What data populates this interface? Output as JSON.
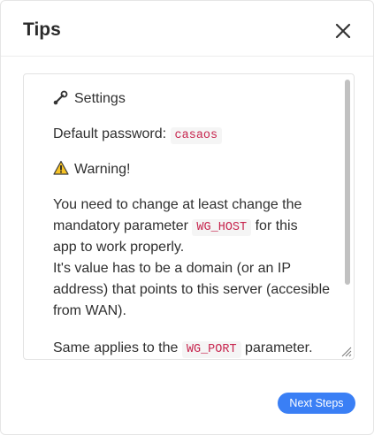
{
  "dialog": {
    "title": "Tips",
    "close_icon": "close-icon"
  },
  "tips": {
    "settings_icon": "wrench-icon",
    "settings_heading": "Settings",
    "default_password_label": "Default password:",
    "default_password_value": "casaos",
    "warning_icon": "warning-icon",
    "warning_heading": "Warning!",
    "paragraph1_line1": "You need to change at least change the",
    "paragraph1_line2_pre": "mandatory parameter",
    "paragraph1_code": "WG_HOST",
    "paragraph1_line2_post": "for this",
    "paragraph1_line3": "app to work properly.",
    "paragraph2_line1": "It's value has to be a domain (or an IP",
    "paragraph2_line2": "address) that points to this server (accesible",
    "paragraph2_line3": "from WAN).",
    "paragraph3_pre": "Same applies to the",
    "paragraph3_code": "WG_PORT",
    "paragraph3_post": "parameter."
  },
  "footer": {
    "next_button_label": "Next Steps",
    "button_color": "#3a7ff5"
  }
}
